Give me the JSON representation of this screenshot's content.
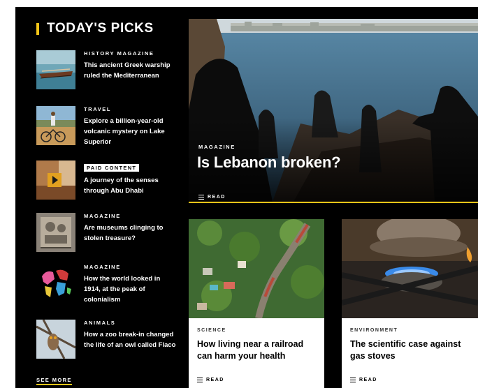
{
  "picks": {
    "title": "TODAY'S PICKS",
    "items": [
      {
        "kicker": "HISTORY MAGAZINE",
        "title": "This ancient Greek warship ruled the Mediterranean"
      },
      {
        "kicker": "TRAVEL",
        "title": "Explore a billion-year-old volcanic mystery on Lake Superior"
      },
      {
        "kicker": "PAID CONTENT",
        "title": "A journey of the senses through Abu Dhabi"
      },
      {
        "kicker": "MAGAZINE",
        "title": "Are museums clinging to stolen treasure?"
      },
      {
        "kicker": "MAGAZINE",
        "title": "How the world looked in 1914, at the peak of colonialism"
      },
      {
        "kicker": "ANIMALS",
        "title": "How a zoo break-in changed the life of an owl called Flaco"
      }
    ],
    "see_more": "SEE MORE"
  },
  "hero": {
    "kicker": "MAGAZINE",
    "title": "Is Lebanon broken?",
    "read": "READ"
  },
  "cards": [
    {
      "kicker": "SCIENCE",
      "title": "How living near a railroad can harm your health",
      "read": "READ"
    },
    {
      "kicker": "ENVIRONMENT",
      "title": "The scientific case against gas stoves",
      "read": "READ"
    }
  ],
  "colors": {
    "accent": "#f5c518",
    "background": "#000000"
  }
}
